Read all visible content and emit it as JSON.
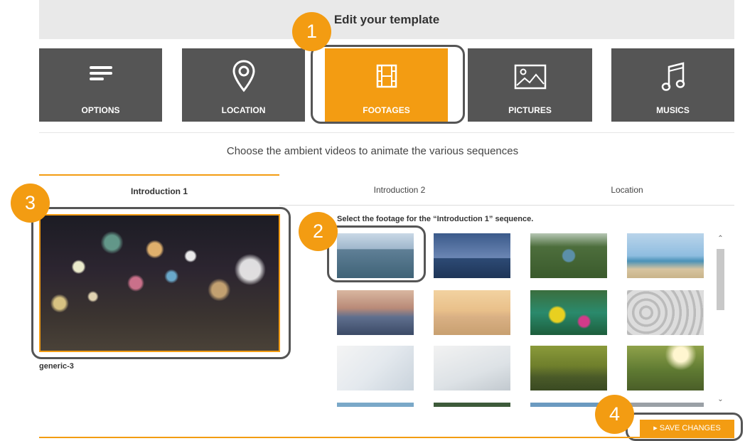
{
  "header": {
    "title": "Edit your template"
  },
  "tabs": [
    {
      "label": "OPTIONS",
      "icon": "menu-icon"
    },
    {
      "label": "LOCATION",
      "icon": "map-pin-icon"
    },
    {
      "label": "FOOTAGES",
      "icon": "film-icon",
      "active": true
    },
    {
      "label": "PICTURES",
      "icon": "picture-icon"
    },
    {
      "label": "MUSICS",
      "icon": "music-icon"
    }
  ],
  "subtitle": "Choose the ambient videos to animate the various sequences",
  "sequence_tabs": [
    {
      "label": "Introduction 1",
      "active": true
    },
    {
      "label": "Introduction 2"
    },
    {
      "label": "Location"
    }
  ],
  "preview": {
    "name": "generic-3"
  },
  "footage": {
    "heading": "Select the footage for the “Introduction 1” sequence.",
    "items": [
      "city-skyline-water",
      "statue-of-liberty",
      "central-park-aerial",
      "beach-kites",
      "sailboat-sunset",
      "beach-people",
      "kayak-lake",
      "construction-pipes",
      "blueprint-drawing",
      "keys-on-plans",
      "duck-pond",
      "tree-picnic"
    ]
  },
  "annotations": [
    "1",
    "2",
    "3",
    "4"
  ],
  "save_button": {
    "label": "SAVE CHANGES"
  },
  "colors": {
    "accent": "#f39c12",
    "tab_bg": "#555555"
  }
}
